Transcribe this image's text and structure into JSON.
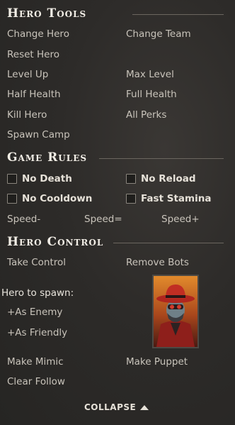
{
  "hero_tools": {
    "title": "Hero Tools",
    "change_hero": "Change Hero",
    "change_team": "Change Team",
    "reset_hero": "Reset Hero",
    "level_up": "Level Up",
    "max_level": "Max Level",
    "half_health": "Half Health",
    "full_health": "Full Health",
    "kill_hero": "Kill Hero",
    "all_perks": "All Perks",
    "spawn_camp": "Spawn Camp"
  },
  "game_rules": {
    "title": "Game Rules",
    "no_death": "No Death",
    "no_reload": "No Reload",
    "no_cooldown": "No Cooldown",
    "fast_stamina": "Fast Stamina",
    "speed_minus": "Speed-",
    "speed_equal": "Speed=",
    "speed_plus": "Speed+"
  },
  "hero_control": {
    "title": "Hero Control",
    "take_control": "Take Control",
    "remove_bots": "Remove Bots",
    "hero_to_spawn": "Hero to spawn:",
    "as_enemy": "+As Enemy",
    "as_friendly": "+As Friendly",
    "make_mimic": "Make Mimic",
    "make_puppet": "Make Puppet",
    "clear_follow": "Clear Follow"
  },
  "footer": {
    "collapse": "COLLAPSE"
  }
}
